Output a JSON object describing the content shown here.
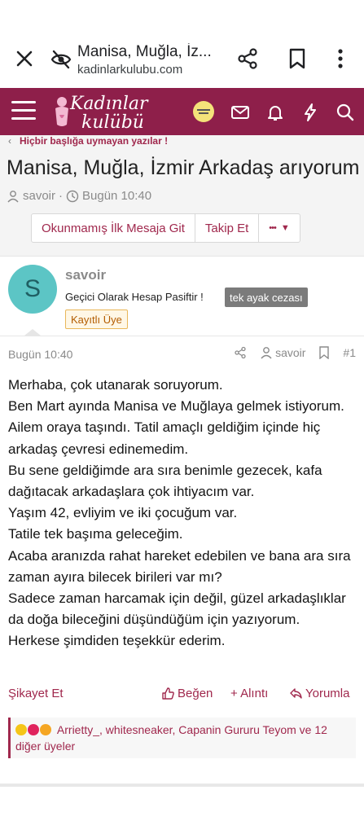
{
  "browser": {
    "page_title": "Manisa, Muğla, İz...",
    "url": "kadinlarkulubu.com"
  },
  "site": {
    "logo_line1": "Kadınlar",
    "logo_line2": "kulübü"
  },
  "breadcrumb": {
    "label": "Hiçbir başlığa uymayan yazılar !"
  },
  "thread": {
    "title": "Manisa, Muğla, İzmir Arkadaş arıyorum",
    "author": "savoir",
    "time": "Bugün 10:40",
    "separator": "·"
  },
  "buttons": {
    "unread": "Okunmamış İlk Mesaja Git",
    "follow": "Takip Et",
    "more": "•••"
  },
  "user": {
    "initial": "S",
    "name": "savoir",
    "status": "Geçici Olarak Hesap Pasiftir !",
    "badge": "tek ayak cezası",
    "role": "Kayıtlı Üye"
  },
  "post": {
    "time": "Bugün 10:40",
    "author": "savoir",
    "number": "#1",
    "paragraphs": [
      "Merhaba, çok utanarak soruyorum.",
      "Ben Mart ayında Manisa ve Muğlaya gelmek istiyorum. Ailem oraya taşındı. Tatil amaçlı geldiğim içinde hiç arkadaş çevresi edinemedim.",
      "Bu sene geldiğimde ara sıra benimle gezecek, kafa dağıtacak arkadaşlara çok ihtiyacım var.",
      "Yaşım 42, evliyim ve iki çocuğum var.",
      "Tatile tek başıma geleceğim.",
      "Acaba aranızda rahat hareket edebilen ve bana ara sıra zaman ayıra bilecek birileri var mı?",
      "Sadece zaman harcamak için değil, güzel arkadaşlıklar da doğa bileceğini düşündüğüm için yazıyorum.",
      "Herkese şimdiden teşekkür ederim."
    ],
    "report": "Şikayet Et",
    "like": "Beğen",
    "quote": "+ Alıntı",
    "reply": "Yorumla",
    "reactions_text": "Arrietty_, whitesneaker, Capanin Gururu Teyom ve 12 diğer üyeler"
  },
  "colors": {
    "brand": "#8e1f4a",
    "link": "#a0284d",
    "avatar_bg": "#5cc5c5"
  },
  "icons": [
    "close-icon",
    "incognito-eye-icon",
    "share-icon",
    "bookmark-icon",
    "more-vert-icon",
    "hamburger-icon",
    "envelope-icon",
    "bell-icon",
    "bolt-icon",
    "search-icon",
    "user-icon",
    "clock-icon",
    "thumbs-up-icon",
    "reply-icon"
  ]
}
